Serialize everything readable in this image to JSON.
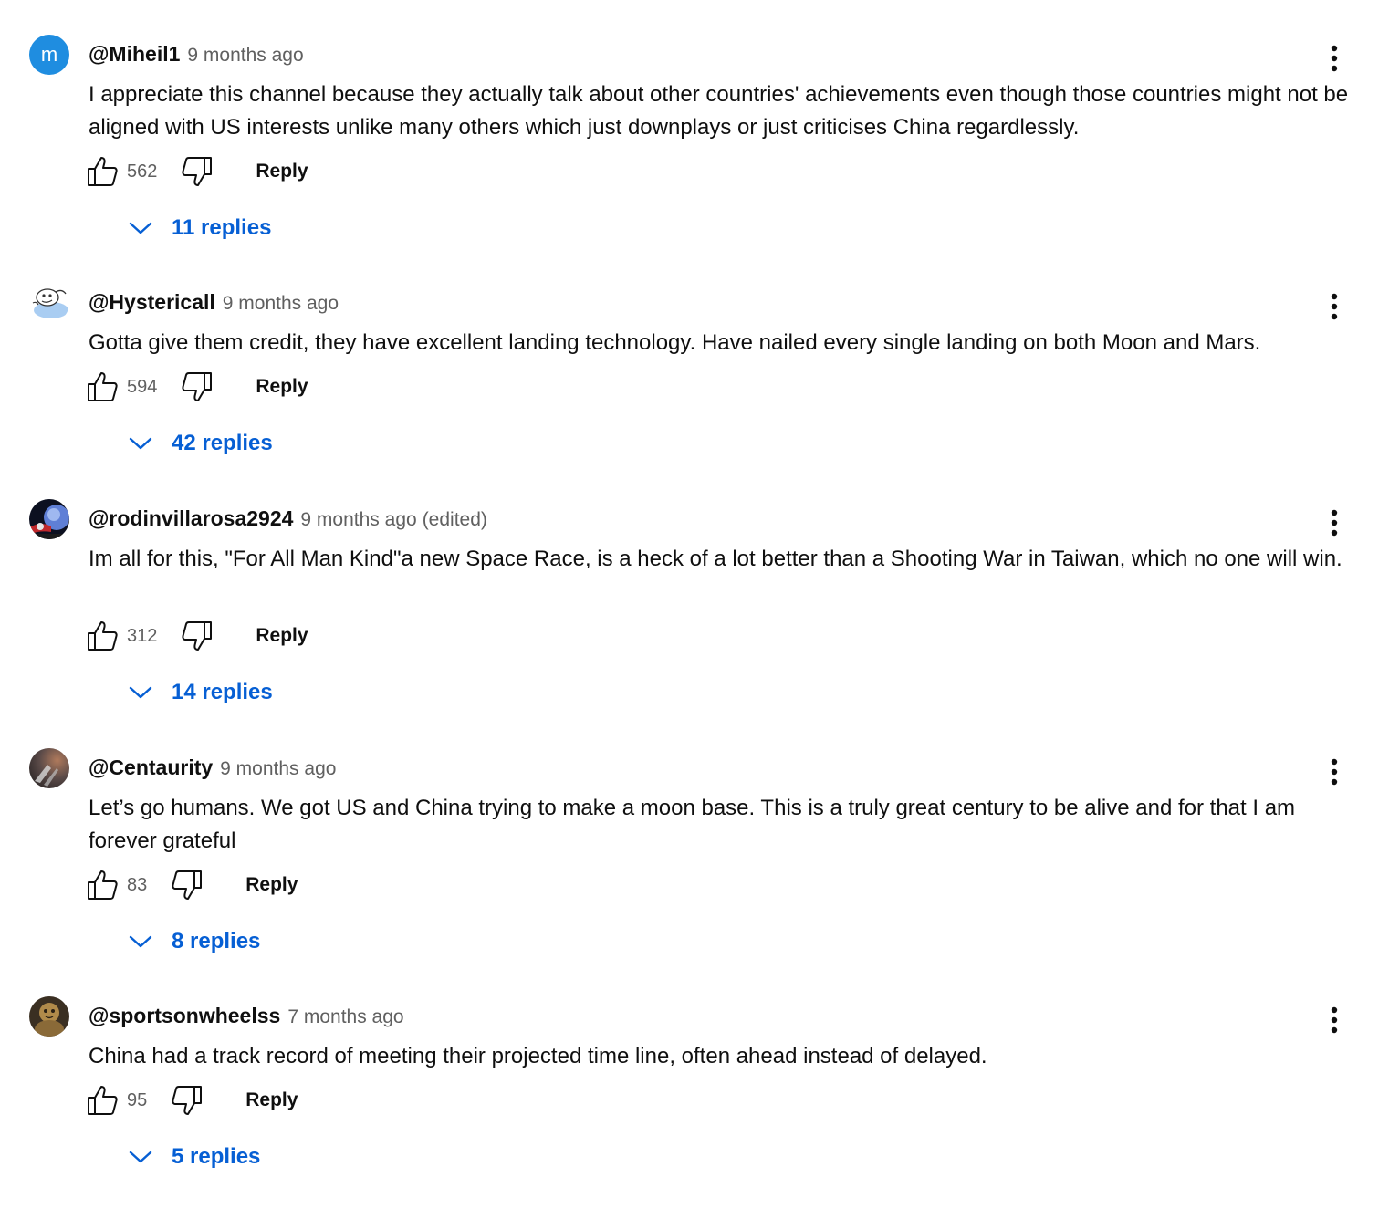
{
  "comments": [
    {
      "author": "@Miheil1",
      "time": "9 months ago",
      "edited": "",
      "avatar_icon": "letter-avatar",
      "avatar_letter": "m",
      "avatar_color": "#1f8de0",
      "text": "I appreciate this channel because they actually talk about other countries' achievements even though those countries might not be aligned with US interests unlike many others which just downplays or just criticises China regardlessly.",
      "likes": "562",
      "reply_label": "Reply",
      "replies_label": "11 replies"
    },
    {
      "author": "@Hystericall",
      "time": "9 months ago",
      "edited": "",
      "avatar_icon": "cartoon-avatar",
      "text": "Gotta give them credit, they have excellent landing technology.  Have nailed every single landing on both Moon and Mars.",
      "likes": "594",
      "reply_label": "Reply",
      "replies_label": "42 replies"
    },
    {
      "author": "@rodinvillarosa2924",
      "time": "9 months ago",
      "edited": "(edited)",
      "avatar_icon": "space-avatar",
      "text": "Im all for this, \"For All Man Kind\"a new Space Race, is a heck of a lot better than a Shooting War in Taiwan, which no one will win.",
      "likes": "312",
      "reply_label": "Reply",
      "replies_label": "14 replies"
    },
    {
      "author": "@Centaurity",
      "time": "9 months ago",
      "edited": "",
      "avatar_icon": "dark-photo-avatar",
      "text": "Let’s go humans. We got US and China trying to make a moon base. This is a truly great century to be alive and for that I am forever grateful",
      "likes": "83",
      "reply_label": "Reply",
      "replies_label": "8 replies"
    },
    {
      "author": "@sportsonwheelss",
      "time": "7 months ago",
      "edited": "",
      "avatar_icon": "bronze-photo-avatar",
      "text": "China had a track record of meeting their projected time line, often ahead instead of delayed.",
      "likes": "95",
      "reply_label": "Reply",
      "replies_label": "5 replies"
    }
  ],
  "colors": {
    "link_blue": "#065fd4",
    "secondary_text": "#606060",
    "primary_text": "#0f0f0f"
  }
}
